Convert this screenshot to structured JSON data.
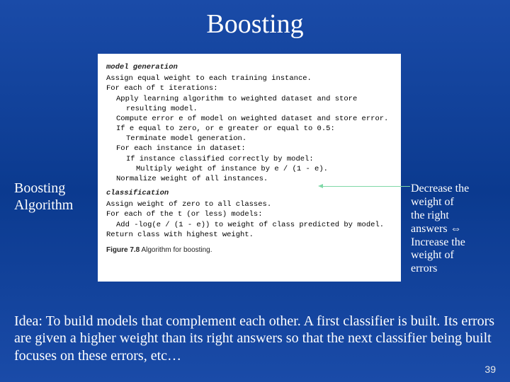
{
  "title": "Boosting",
  "leftLabel": {
    "line1": "Boosting",
    "line2": "Algorithm"
  },
  "algo": {
    "sectionModelGen": "model generation",
    "l1": "Assign equal weight to each training instance.",
    "l2": "For each of t iterations:",
    "l3": "Apply learning algorithm to weighted dataset and store",
    "l4": "resulting model.",
    "l5": "Compute error e of model on weighted dataset and store error.",
    "l6": "If e equal to zero, or e greater or equal to 0.5:",
    "l7": "Terminate model generation.",
    "l8": "For each instance in dataset:",
    "l9": "If instance classified correctly by model:",
    "l10": "Multiply weight of instance by e / (1 - e).",
    "l11": "Normalize weight of all instances.",
    "sectionClassification": "classification",
    "c1": "Assign weight of zero to all classes.",
    "c2": "For each of the t (or less) models:",
    "c3": "Add -log(e / (1 - e)) to weight of class predicted by model.",
    "c4": "Return class with highest weight.",
    "captionLabel": "Figure 7.8",
    "captionText": " Algorithm for boosting."
  },
  "rightNote": {
    "t1": "Decrease the",
    "t2": "weight of",
    "t3": "the right",
    "t4a": "answers ",
    "arrow": "⇔",
    "t5": "Increase the",
    "t6": "weight of",
    "t7": "errors"
  },
  "idea": "Idea: To build models that complement each other. A first classifier is built. Its errors are given a higher weight than its right answers so that the next classifier being built focuses on these errors, etc…",
  "pageNum": "39"
}
